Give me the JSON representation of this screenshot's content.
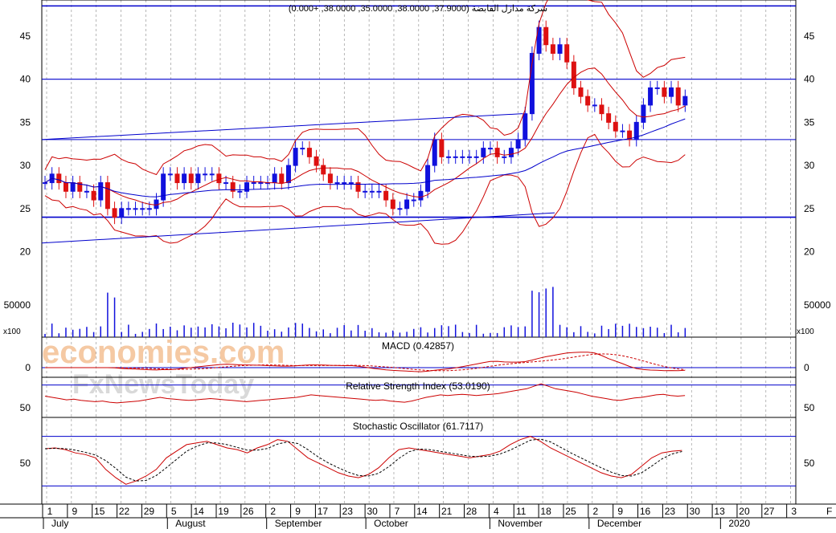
{
  "main_title": "شركة مدازل القابضة (37.9000, 38.0000, 35.0000, 38.0000, +0.000)",
  "panels": {
    "price_ticks": [
      "45",
      "40",
      "35",
      "30",
      "25",
      "20"
    ],
    "volume_tick": "50000",
    "volume_multiplier": "x100",
    "macd": {
      "title": "MACD (0.42857)",
      "tick": "0"
    },
    "rsi": {
      "title": "Relative Strength Index (53.0190)",
      "tick": "50"
    },
    "stoch": {
      "title": "Stochastic Oscillator (61.7117)",
      "tick": "50"
    }
  },
  "watermark": {
    "line1": "economies.com",
    "line2": "FxNewsToday"
  },
  "colors": {
    "up": "#1111dd",
    "down": "#dd1111",
    "grid": "#888888",
    "band": "#cc0000",
    "line": "#0000cc"
  },
  "x_axis": {
    "days": [
      "1",
      "9",
      "15",
      "22",
      "29",
      "5",
      "14",
      "19",
      "26",
      "2",
      "9",
      "17",
      "23",
      "30",
      "7",
      "14",
      "21",
      "28",
      "4",
      "11",
      "18",
      "25",
      "2",
      "9",
      "16",
      "23",
      "30",
      "13",
      "20",
      "27",
      "3"
    ],
    "months": [
      "July",
      "August",
      "September",
      "October",
      "November",
      "December",
      "2020"
    ],
    "extra_letter": "F"
  },
  "chart_data": {
    "type": "line",
    "y_range_price": [
      18,
      49
    ],
    "horizontal_levels": [
      48.5,
      40,
      33,
      24
    ],
    "close_series": [
      28,
      29,
      28,
      27,
      28,
      27,
      27,
      26,
      28,
      25,
      24,
      25,
      25,
      25,
      25,
      25,
      26,
      29,
      29,
      28,
      29,
      28,
      29,
      29,
      29,
      28,
      28,
      27,
      27,
      28,
      28,
      28,
      28,
      29,
      28,
      30,
      32,
      32,
      31,
      30,
      29,
      28,
      28,
      28,
      28,
      27,
      27,
      27,
      27,
      26,
      25,
      25,
      26,
      26,
      27,
      30,
      33,
      31,
      31,
      31,
      31,
      31,
      31,
      32,
      32,
      31,
      31,
      32,
      33,
      36,
      43,
      46,
      44,
      43,
      44,
      42,
      39,
      38,
      37,
      37,
      36,
      35,
      34,
      34,
      33,
      35,
      37,
      39,
      39,
      38,
      39,
      37,
      38
    ],
    "rsi_series": [
      52,
      50,
      48,
      46,
      47,
      45,
      44,
      43,
      44,
      42,
      41,
      42,
      43,
      44,
      46,
      48,
      50,
      48,
      47,
      46,
      45,
      46,
      47,
      48,
      47,
      46,
      45,
      44,
      43,
      44,
      45,
      46,
      47,
      48,
      49,
      50,
      52,
      54,
      53,
      52,
      51,
      50,
      49,
      48,
      47,
      46,
      45,
      46,
      44,
      43,
      42,
      44,
      47,
      50,
      52,
      54,
      53,
      54,
      55,
      54,
      53,
      54,
      55,
      56,
      58,
      60,
      62,
      64,
      68,
      72,
      68,
      64,
      62,
      60,
      58,
      55,
      52,
      50,
      48,
      46,
      45,
      47,
      49,
      50,
      52,
      54,
      55,
      53,
      52,
      53
    ],
    "stoch_series": [
      65,
      66,
      64,
      60,
      58,
      54,
      40,
      30,
      22,
      26,
      32,
      40,
      54,
      62,
      70,
      72,
      74,
      70,
      66,
      64,
      60,
      66,
      70,
      76,
      74,
      64,
      54,
      48,
      42,
      36,
      32,
      30,
      34,
      42,
      54,
      64,
      66,
      64,
      62,
      60,
      58,
      56,
      54,
      56,
      58,
      62,
      70,
      76,
      80,
      74,
      66,
      60,
      54,
      48,
      42,
      36,
      32,
      30,
      34,
      44,
      54,
      60,
      62,
      63
    ]
  }
}
